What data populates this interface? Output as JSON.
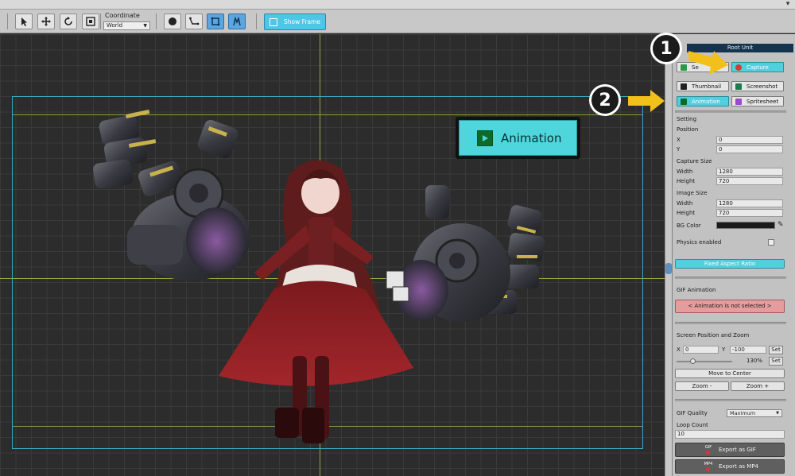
{
  "title_bar": {
    "close_glyph": "▾"
  },
  "toolbar": {
    "tools": [
      "select-tool",
      "move-tool",
      "rotate-tool",
      "scale-tool"
    ],
    "coordinate_label": "Coordinate",
    "coordinate_value": "World",
    "view_tools": [
      "onion-tool",
      "bone-tool",
      "mesh-tool",
      "paint-tool"
    ],
    "show_frame_label": "Show Frame"
  },
  "callouts": {
    "badge_1": "1",
    "badge_2": "2",
    "animation_label": "Animation"
  },
  "panel": {
    "header": "Root Unit",
    "tab_left_partial": "Se",
    "capture_label": "Capture",
    "thumbnail_label": "Thumbnail",
    "screenshot_label": "Screenshot",
    "animation_label": "Animation",
    "spritesheet_label": "Spritesheet",
    "setting_label": "Setting",
    "position_label": "Position",
    "x_label": "X",
    "x_value": "0",
    "y_label": "Y",
    "y_value": "0",
    "capture_size_label": "Capture Size",
    "cap_width_label": "Width",
    "cap_width_value": "1280",
    "cap_height_label": "Height",
    "cap_height_value": "720",
    "image_size_label": "Image Size",
    "img_width_label": "Width",
    "img_width_value": "1280",
    "img_height_label": "Height",
    "img_height_value": "720",
    "bg_color_label": "BG Color",
    "bg_color_value": "#1a1a1a",
    "physics_label": "Physics enabled",
    "fixed_aspect_label": "Fixed Aspect Ratio",
    "gif_animation_label": "GIF Animation",
    "anim_not_selected": "< Animation is not selected >",
    "screen_pos_zoom_label": "Screen Position and Zoom",
    "sp_x_label": "X",
    "sp_x_value": "0",
    "sp_y_label": "Y",
    "sp_y_value": "-100",
    "set_label": "Set",
    "zoom_percent": "130%",
    "zoom_level": 0.3,
    "move_to_center": "Move to Center",
    "zoom_minus": "Zoom -",
    "zoom_plus": "Zoom +",
    "gif_quality_label": "GIF Quality",
    "gif_quality_value": "Maximum",
    "loop_count_label": "Loop Count",
    "loop_count_value": "10",
    "export_gif": "Export as GIF",
    "export_mp4": "Export as MP4",
    "gif_tag": "GIF",
    "mp4_tag": "MP4"
  },
  "colors": {
    "accent_cyan": "#52cfdc",
    "warning_red": "#e49c9c",
    "callout_arrow": "#f2c01a"
  }
}
